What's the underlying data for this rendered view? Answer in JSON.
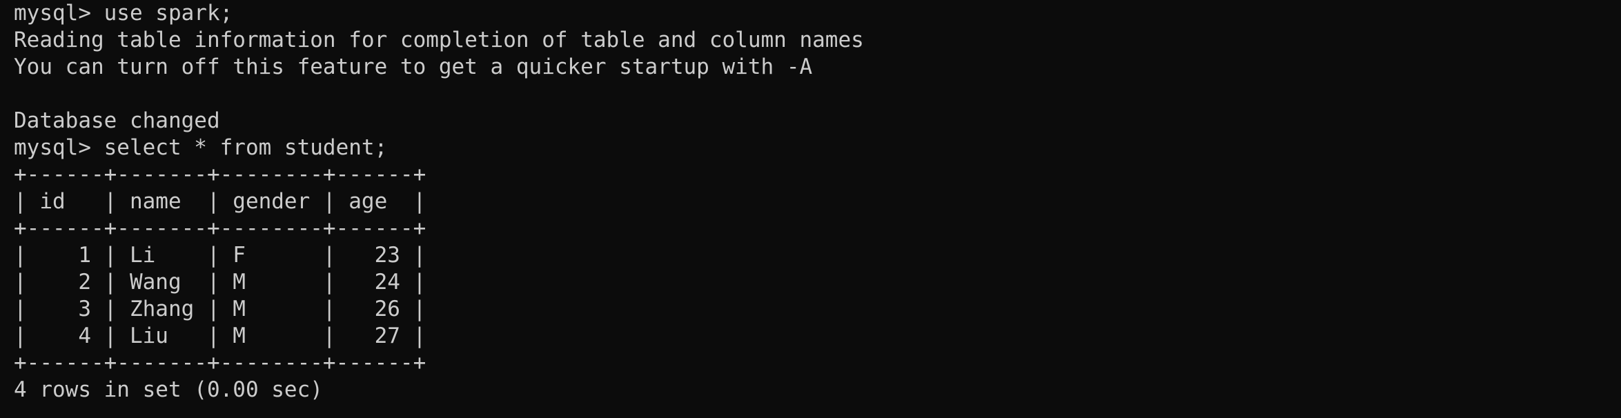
{
  "terminal": {
    "lines": [
      "mysql> use spark;",
      "Reading table information for completion of table and column names",
      "You can turn off this feature to get a quicker startup with -A",
      "",
      "Database changed",
      "mysql> select * from student;",
      "+------+-------+--------+------+",
      "| id   | name  | gender | age  |",
      "+------+-------+--------+------+",
      "|    1 | Li    | F      |   23 |",
      "|    2 | Wang  | M      |   24 |",
      "|    3 | Zhang | M      |   26 |",
      "|    4 | Liu   | M      |   27 |",
      "+------+-------+--------+------+",
      "4 rows in set (0.00 sec)"
    ]
  }
}
